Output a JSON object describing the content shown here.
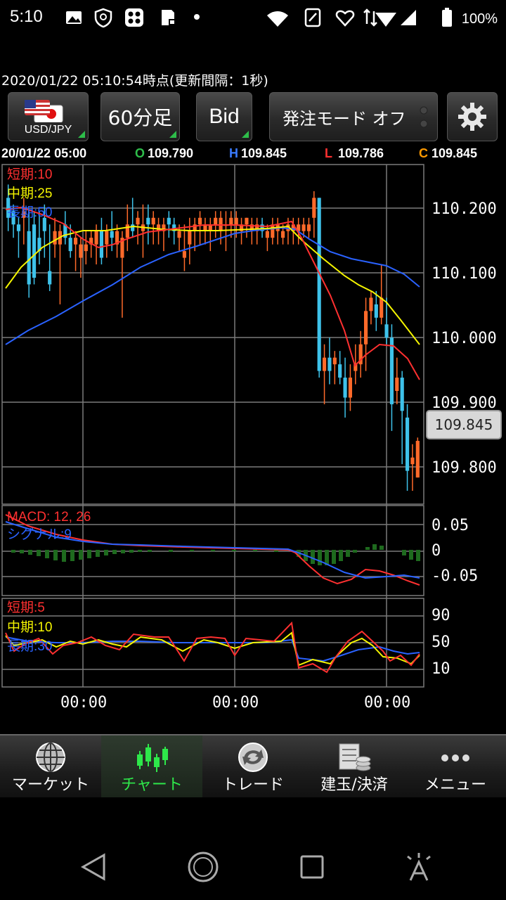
{
  "status_bar": {
    "time": "5:10",
    "battery": "100%"
  },
  "header": {
    "timestamp": "2020/01/22  05:10:54時点(更新間隔：1秒)"
  },
  "toolbar": {
    "pair_label": "USD/JPY",
    "timeframe_label": "60分足",
    "price_type_label": "Bid",
    "order_mode_label": "発注モード オフ",
    "settings_icon": "gear-icon"
  },
  "ohlc": {
    "datetime": "20/01/22 05:00",
    "o_label": "O",
    "o_value": "109.790",
    "h_label": "H",
    "h_value": "109.845",
    "l_label": "L",
    "l_value": "109.786",
    "c_label": "C",
    "c_value": "109.845"
  },
  "chart": {
    "price_axis": [
      "110.200",
      "110.100",
      "110.000",
      "109.900",
      "109.800"
    ],
    "current_price": "109.845",
    "ma_labels": {
      "short": "短期:10",
      "mid": "中期:25",
      "long": "長期:50"
    },
    "macd_labels": {
      "macd": "MACD: 12, 26",
      "signal": "シグナル:9"
    },
    "macd_axis": [
      "0.05",
      "0",
      "-0.05"
    ],
    "rsi_labels": {
      "short": "短期:5",
      "mid": "中期:10",
      "long": "長期:30"
    },
    "rsi_axis": [
      "90",
      "50",
      "10"
    ],
    "time_axis": [
      "00:00",
      "00:00",
      "00:00"
    ]
  },
  "colors": {
    "up_candle": "#ff6a2a",
    "down_candle": "#3ec2ea",
    "ma_short": "#ff3030",
    "ma_mid": "#f5f500",
    "ma_long": "#2a62ff",
    "hist": "#1e6a1e",
    "active_nav": "#2ee84a"
  },
  "nav": [
    {
      "label": "マーケット",
      "icon": "globe-icon"
    },
    {
      "label": "チャート",
      "icon": "candlestick-chart-icon"
    },
    {
      "label": "トレード",
      "icon": "trade-arrows-icon"
    },
    {
      "label": "建玉/決済",
      "icon": "coins-ledger-icon"
    },
    {
      "label": "メニュー",
      "icon": "more-dots-icon"
    }
  ],
  "chart_data": {
    "type": "candlestick",
    "instrument": "USD/JPY",
    "timeframe": "60分足",
    "y_range": [
      109.75,
      110.26
    ],
    "last": {
      "open": 109.79,
      "high": 109.845,
      "low": 109.786,
      "close": 109.845
    },
    "candles": [
      [
        110.21,
        110.23,
        110.16,
        110.18
      ],
      [
        110.19,
        110.2,
        110.15,
        110.17
      ],
      [
        110.17,
        110.18,
        110.12,
        110.16
      ],
      [
        110.18,
        110.21,
        110.14,
        110.19
      ],
      [
        110.16,
        110.19,
        110.06,
        110.08
      ],
      [
        110.17,
        110.19,
        110.08,
        110.09
      ],
      [
        110.15,
        110.19,
        110.11,
        110.13
      ],
      [
        110.18,
        110.2,
        110.12,
        110.16
      ],
      [
        110.1,
        110.17,
        110.07,
        110.08
      ],
      [
        110.14,
        110.18,
        110.12,
        110.16
      ],
      [
        110.14,
        110.17,
        110.05,
        110.16
      ],
      [
        110.17,
        110.19,
        110.14,
        110.15
      ],
      [
        110.15,
        110.17,
        110.12,
        110.13
      ],
      [
        110.14,
        110.16,
        110.1,
        110.15
      ],
      [
        110.12,
        110.15,
        110.09,
        110.14
      ],
      [
        110.13,
        110.16,
        110.11,
        110.14
      ],
      [
        110.14,
        110.16,
        110.12,
        110.15
      ],
      [
        110.14,
        110.17,
        110.11,
        110.16
      ],
      [
        110.16,
        110.18,
        110.11,
        110.12
      ],
      [
        110.14,
        110.17,
        110.12,
        110.16
      ],
      [
        110.16,
        110.19,
        110.13,
        110.15
      ],
      [
        110.14,
        110.17,
        110.12,
        110.16
      ],
      [
        110.12,
        110.16,
        110.03,
        110.15
      ],
      [
        110.15,
        110.2,
        110.13,
        110.17
      ],
      [
        110.17,
        110.21,
        110.15,
        110.16
      ],
      [
        110.17,
        110.19,
        110.14,
        110.18
      ],
      [
        110.16,
        110.2,
        110.12,
        110.17
      ],
      [
        110.18,
        110.2,
        110.14,
        110.17
      ],
      [
        110.17,
        110.19,
        110.14,
        110.18
      ],
      [
        110.16,
        110.18,
        110.14,
        110.17
      ],
      [
        110.16,
        110.18,
        110.13,
        110.17
      ],
      [
        110.18,
        110.19,
        110.15,
        110.17
      ],
      [
        110.17,
        110.18,
        110.14,
        110.16
      ],
      [
        110.15,
        110.17,
        110.13,
        110.16
      ],
      [
        110.12,
        110.17,
        110.1,
        110.13
      ],
      [
        110.14,
        110.18,
        110.11,
        110.16
      ],
      [
        110.16,
        110.18,
        110.13,
        110.17
      ],
      [
        110.17,
        110.19,
        110.14,
        110.18
      ],
      [
        110.16,
        110.18,
        110.14,
        110.17
      ],
      [
        110.16,
        110.18,
        110.13,
        110.17
      ],
      [
        110.17,
        110.19,
        110.15,
        110.18
      ],
      [
        110.16,
        110.19,
        110.14,
        110.18
      ],
      [
        110.17,
        110.19,
        110.13,
        110.17
      ],
      [
        110.17,
        110.19,
        110.15,
        110.18
      ],
      [
        110.17,
        110.19,
        110.15,
        110.18
      ],
      [
        110.16,
        110.18,
        110.14,
        110.17
      ],
      [
        110.17,
        110.18,
        110.15,
        110.18
      ],
      [
        110.16,
        110.18,
        110.14,
        110.17
      ],
      [
        110.16,
        110.18,
        110.14,
        110.17
      ],
      [
        110.17,
        110.18,
        110.15,
        110.16
      ],
      [
        110.15,
        110.17,
        110.13,
        110.16
      ],
      [
        110.15,
        110.18,
        110.14,
        110.17
      ],
      [
        110.16,
        110.18,
        110.14,
        110.17
      ],
      [
        110.15,
        110.17,
        110.14,
        110.16
      ],
      [
        110.16,
        110.18,
        110.14,
        110.17
      ],
      [
        110.16,
        110.18,
        110.14,
        110.17
      ],
      [
        110.16,
        110.18,
        110.14,
        110.17
      ],
      [
        110.16,
        110.18,
        110.15,
        110.17
      ],
      [
        110.16,
        110.18,
        110.15,
        110.17
      ],
      [
        110.18,
        110.22,
        110.15,
        110.21
      ],
      [
        110.21,
        110.21,
        109.94,
        109.95
      ],
      [
        109.95,
        109.99,
        109.9,
        109.97
      ],
      [
        109.97,
        110.0,
        109.93,
        109.95
      ],
      [
        109.96,
        109.98,
        109.93,
        109.97
      ],
      [
        109.96,
        109.98,
        109.93,
        109.94
      ],
      [
        109.94,
        109.97,
        109.88,
        109.91
      ],
      [
        109.91,
        109.96,
        109.89,
        109.94
      ],
      [
        109.95,
        109.99,
        109.93,
        109.96
      ],
      [
        109.96,
        110.01,
        109.94,
        109.99
      ],
      [
        109.99,
        110.06,
        109.95,
        110.04
      ],
      [
        110.04,
        110.07,
        110.02,
        110.06
      ],
      [
        110.05,
        110.07,
        110.01,
        110.03
      ],
      [
        110.03,
        110.11,
        110.02,
        110.06
      ],
      [
        110.02,
        110.06,
        109.99,
        110.0
      ],
      [
        110.0,
        110.02,
        109.86,
        109.9
      ],
      [
        109.92,
        109.97,
        109.9,
        109.94
      ],
      [
        109.94,
        109.95,
        109.81,
        109.89
      ],
      [
        109.88,
        109.9,
        109.77,
        109.8
      ],
      [
        109.81,
        109.84,
        109.77,
        109.82
      ],
      [
        109.79,
        109.85,
        109.79,
        109.845
      ]
    ]
  }
}
